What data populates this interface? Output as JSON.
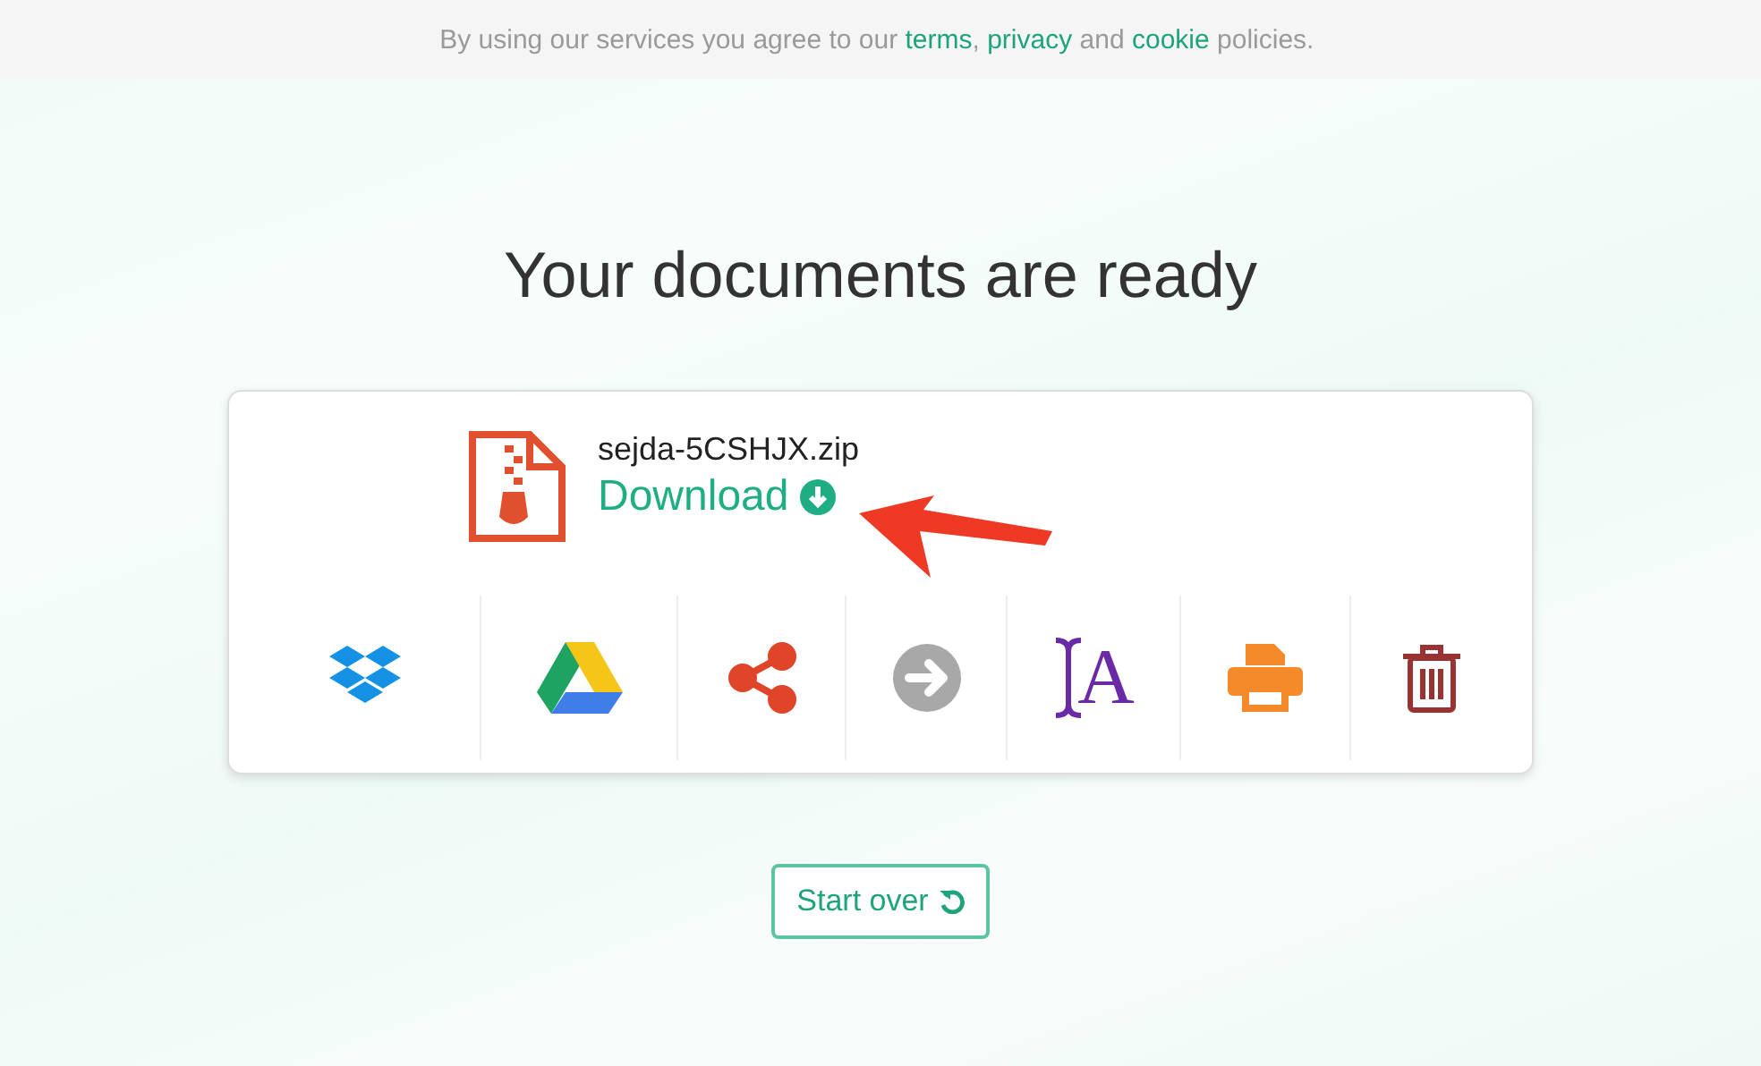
{
  "notice": {
    "text": "By using our services you agree to our",
    "links": [
      {
        "kind": "link",
        "text": "terms"
      },
      {
        "kind": "text",
        "text": ","
      },
      {
        "kind": "link",
        "text": "privacy"
      },
      {
        "kind": "text",
        "text": "and"
      },
      {
        "kind": "link",
        "text": "cookie"
      },
      {
        "kind": "text",
        "text": "policies."
      }
    ]
  },
  "heading": "Your documents are ready",
  "file": {
    "name": "sejda-5CSHJX.zip",
    "download": "Download"
  },
  "actions": [
    {
      "kind": "dropbox"
    },
    {
      "kind": "drive"
    },
    {
      "kind": "share"
    },
    {
      "kind": "forward"
    },
    {
      "kind": "ocr",
      "glyph": "A"
    },
    {
      "kind": "print"
    },
    {
      "kind": "delete"
    }
  ],
  "start_over": "Start over"
}
